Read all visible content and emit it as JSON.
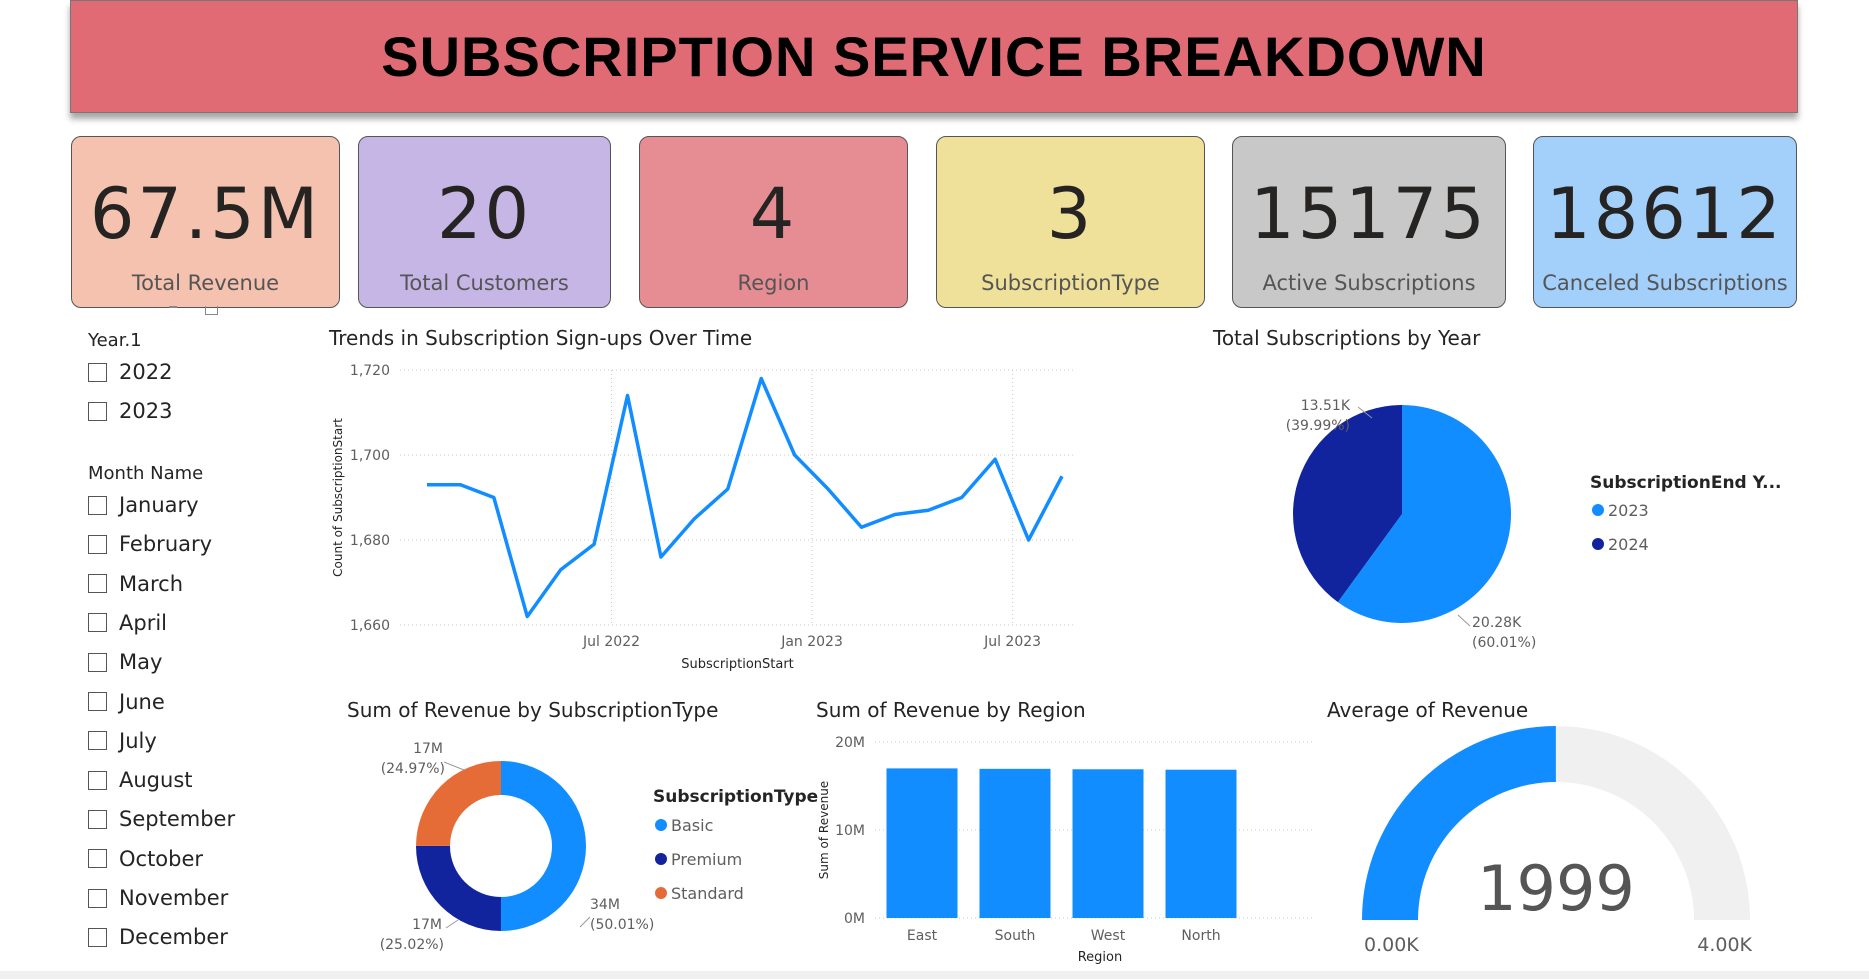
{
  "header": {
    "title": "SUBSCRIPTION SERVICE BREAKDOWN"
  },
  "kpis": [
    {
      "value": "67.5M",
      "label": "Total Revenue",
      "color": "#f4c2ae"
    },
    {
      "value": "20",
      "label": "Total Customers",
      "color": "#c6b6e6"
    },
    {
      "value": "4",
      "label": "Region",
      "color": "#e68d94"
    },
    {
      "value": "3",
      "label": "SubscriptionType",
      "color": "#f0e19a"
    },
    {
      "value": "15175",
      "label": "Active Subscriptions",
      "color": "#c8c8c8"
    },
    {
      "value": "18612",
      "label": "Canceled Subscriptions",
      "color": "#a3cffb"
    }
  ],
  "slicers": {
    "year": {
      "title": "Year.1",
      "items": [
        "2022",
        "2023"
      ]
    },
    "month": {
      "title": "Month Name",
      "items": [
        "January",
        "February",
        "March",
        "April",
        "May",
        "June",
        "July",
        "August",
        "September",
        "October",
        "November",
        "December"
      ]
    }
  },
  "colors": {
    "blue": "#118dff",
    "navy": "#12239e",
    "orange": "#e66c37",
    "gauge_track": "#f0f0f0"
  },
  "chart_data": [
    {
      "type": "line",
      "title": "Trends in Subscription Sign-ups Over Time",
      "xlabel": "SubscriptionStart",
      "ylabel": "Count of SubscriptionStart",
      "x_ticks": [
        "Jul 2022",
        "Jan 2023",
        "Jul 2023"
      ],
      "y_ticks": [
        "1,720",
        "1,700",
        "1,680",
        "1,660"
      ],
      "ylim": [
        1660,
        1720
      ],
      "x": [
        "2022-01",
        "2022-02",
        "2022-03",
        "2022-04",
        "2022-05",
        "2022-06",
        "2022-07",
        "2022-08",
        "2022-09",
        "2022-10",
        "2022-11",
        "2022-12",
        "2023-01",
        "2023-02",
        "2023-03",
        "2023-04",
        "2023-05",
        "2023-06",
        "2023-07",
        "2023-08",
        "2023-09"
      ],
      "values": [
        1693,
        1693,
        1690,
        1662,
        1673,
        1679,
        1714,
        1676,
        1685,
        1692,
        1718,
        1700,
        1692,
        1683,
        1686,
        1687,
        1690,
        1699,
        1680,
        1695
      ],
      "grid": true
    },
    {
      "type": "pie",
      "title": "Total Subscriptions by Year",
      "legend_title": "SubscriptionEnd Y...",
      "slices": [
        {
          "name": "2023",
          "value": 20.28,
          "label": "20.28K",
          "pct": "(60.01%)"
        },
        {
          "name": "2024",
          "value": 13.51,
          "label": "13.51K",
          "pct": "(39.99%)"
        }
      ],
      "legend_position": "right"
    },
    {
      "type": "pie",
      "title": "Sum of Revenue by SubscriptionType",
      "legend_title": "SubscriptionType",
      "slices": [
        {
          "name": "Basic",
          "value": 50.01,
          "label": "34M",
          "pct": "(50.01%)"
        },
        {
          "name": "Premium",
          "value": 25.02,
          "label": "17M",
          "pct": "(25.02%)"
        },
        {
          "name": "Standard",
          "value": 24.97,
          "label": "17M",
          "pct": "(24.97%)"
        }
      ],
      "legend_position": "right"
    },
    {
      "type": "bar",
      "title": "Sum of Revenue by Region",
      "xlabel": "Region",
      "ylabel": "Sum of Revenue",
      "categories": [
        "East",
        "South",
        "West",
        "North"
      ],
      "values": [
        17.0,
        16.95,
        16.9,
        16.85
      ],
      "y_ticks": [
        "20M",
        "10M",
        "0M"
      ],
      "ylim": [
        0,
        20
      ]
    },
    {
      "type": "gauge",
      "title": "Average of Revenue",
      "value": 1999,
      "value_label": "1999",
      "min_label": "0.00K",
      "max_label": "4.00K",
      "min": 0,
      "max": 4000
    }
  ]
}
